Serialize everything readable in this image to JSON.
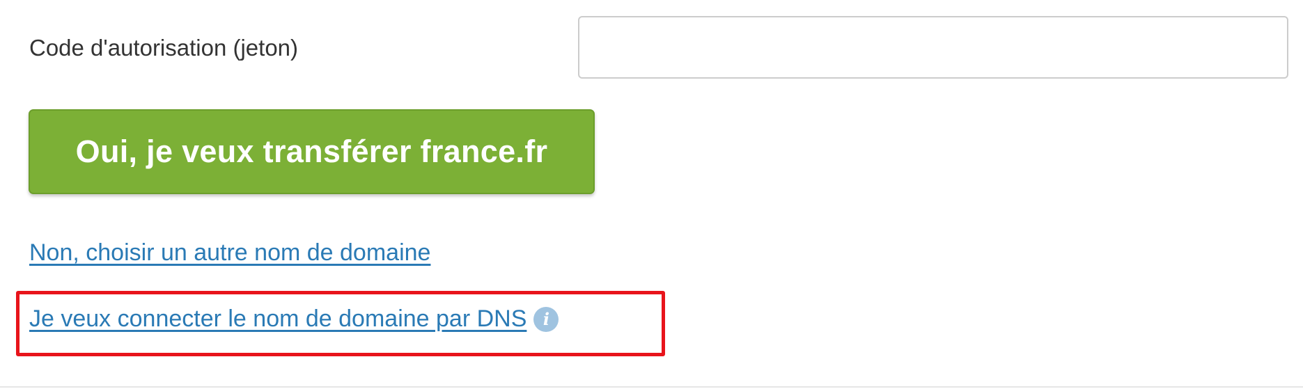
{
  "form": {
    "auth_label": "Code d'autorisation (jeton)",
    "auth_value": "",
    "auth_placeholder": ""
  },
  "actions": {
    "transfer_button_label": "Oui, je veux transférer france.fr",
    "choose_other_link": "Non, choisir un autre nom de domaine",
    "connect_dns_link": "Je veux connecter le nom de domaine par DNS",
    "info_icon_glyph": "i"
  },
  "icons": {
    "info": "info-icon"
  },
  "colors": {
    "button_green": "#7cb036",
    "link_blue": "#2a7ab5",
    "highlight_red": "#e8141b",
    "info_icon": "#9fc3e0"
  }
}
